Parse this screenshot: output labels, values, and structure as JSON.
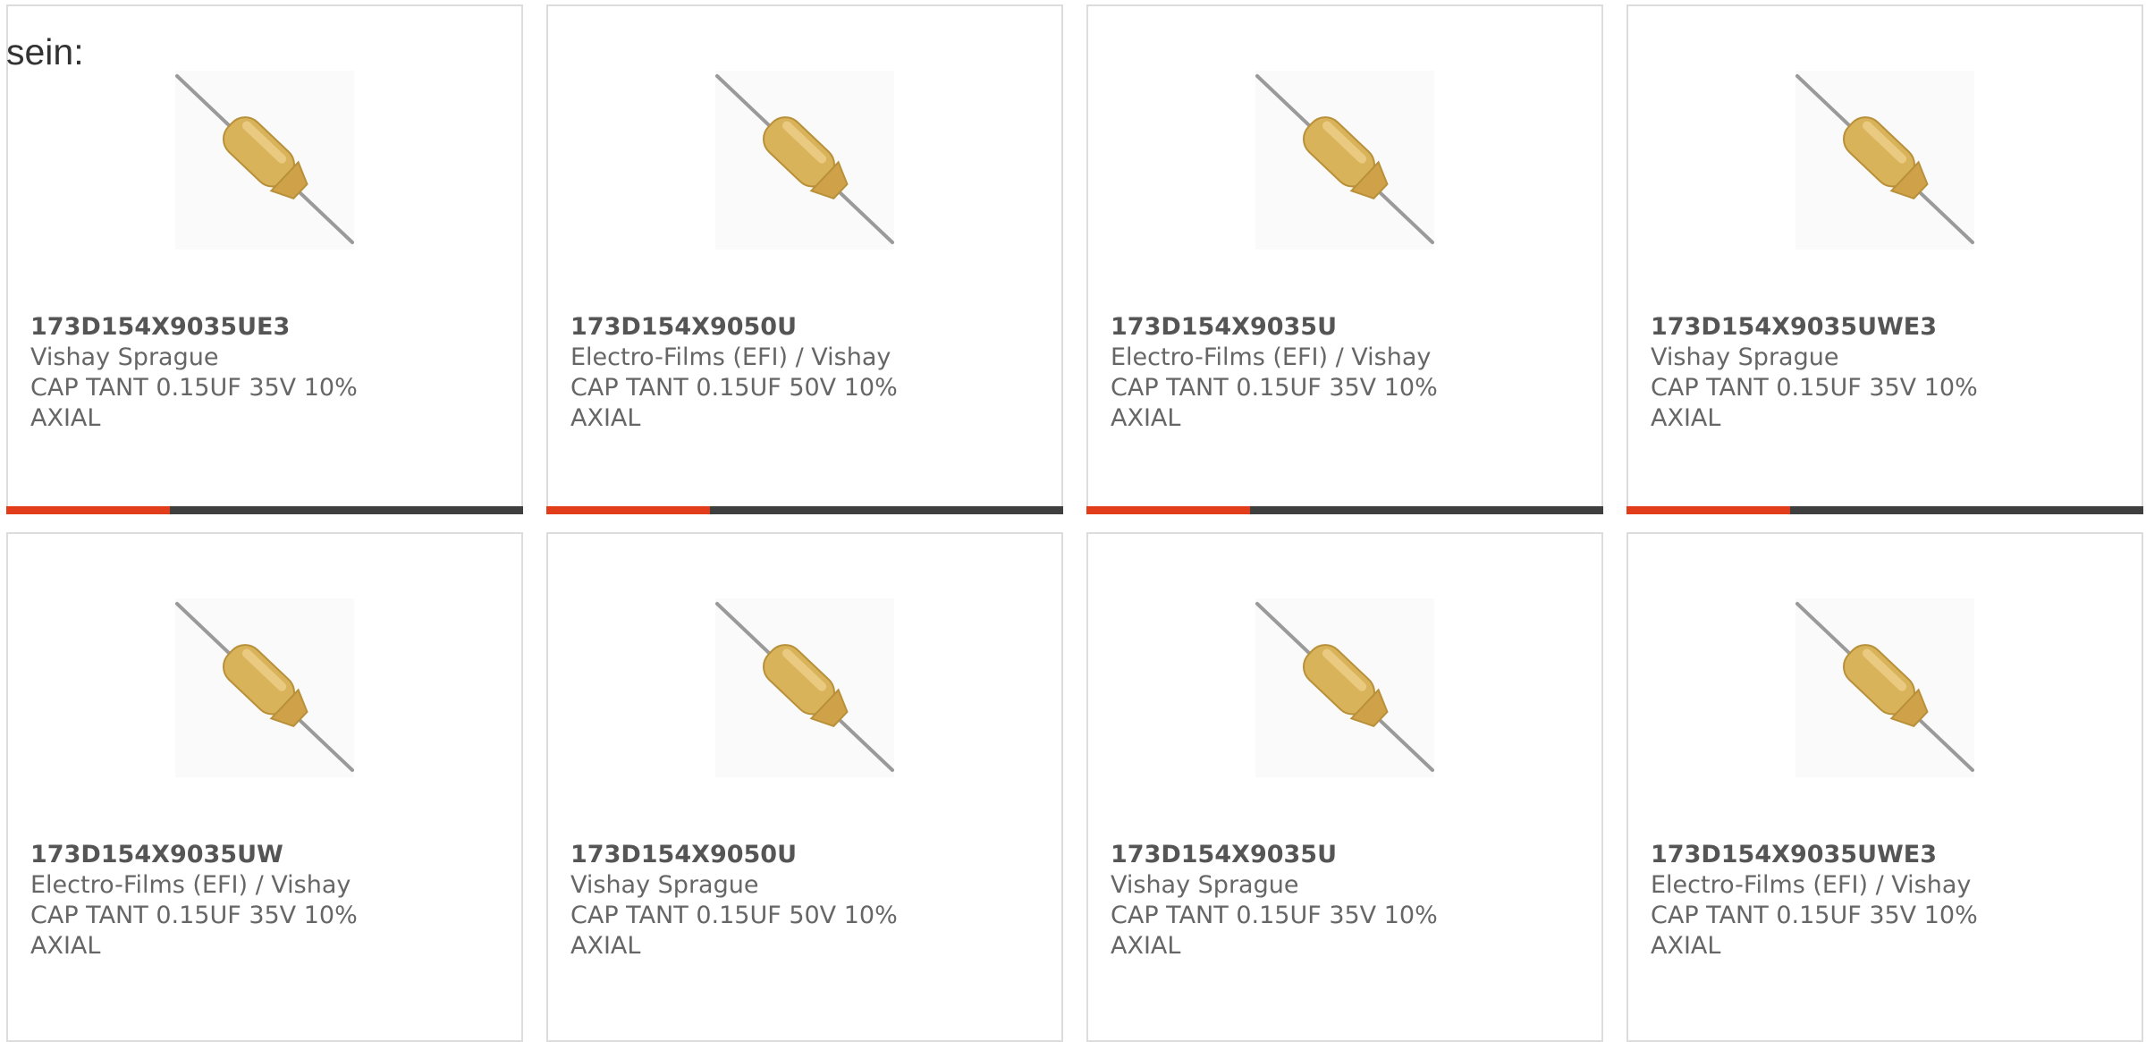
{
  "intro_text": "sein:",
  "colors": {
    "accent": "#e23d1a",
    "bar": "#3f3f3f",
    "border": "#dcdcdc",
    "text": "#666666",
    "capacitor_body": "#d9b35a"
  },
  "image_icon": "axial-tantalum-capacitor",
  "products": [
    {
      "part_number": "173D154X9035UE3",
      "manufacturer": "Vishay Sprague",
      "desc_line1": "CAP TANT 0.15UF 35V 10%",
      "desc_line2": "AXIAL"
    },
    {
      "part_number": "173D154X9050U",
      "manufacturer": "Electro-Films (EFI) / Vishay",
      "desc_line1": "CAP TANT 0.15UF 50V 10%",
      "desc_line2": "AXIAL"
    },
    {
      "part_number": "173D154X9035U",
      "manufacturer": "Electro-Films (EFI) / Vishay",
      "desc_line1": "CAP TANT 0.15UF 35V 10%",
      "desc_line2": "AXIAL"
    },
    {
      "part_number": "173D154X9035UWE3",
      "manufacturer": "Vishay Sprague",
      "desc_line1": "CAP TANT 0.15UF 35V 10%",
      "desc_line2": "AXIAL"
    },
    {
      "part_number": "173D154X9035UW",
      "manufacturer": "Electro-Films (EFI) / Vishay",
      "desc_line1": "CAP TANT 0.15UF 35V 10%",
      "desc_line2": "AXIAL"
    },
    {
      "part_number": "173D154X9050U",
      "manufacturer": "Vishay Sprague",
      "desc_line1": "CAP TANT 0.15UF 50V 10%",
      "desc_line2": "AXIAL"
    },
    {
      "part_number": "173D154X9035U",
      "manufacturer": "Vishay Sprague",
      "desc_line1": "CAP TANT 0.15UF 35V 10%",
      "desc_line2": "AXIAL"
    },
    {
      "part_number": "173D154X9035UWE3",
      "manufacturer": "Electro-Films (EFI) / Vishay",
      "desc_line1": "CAP TANT 0.15UF 35V 10%",
      "desc_line2": "AXIAL"
    }
  ]
}
